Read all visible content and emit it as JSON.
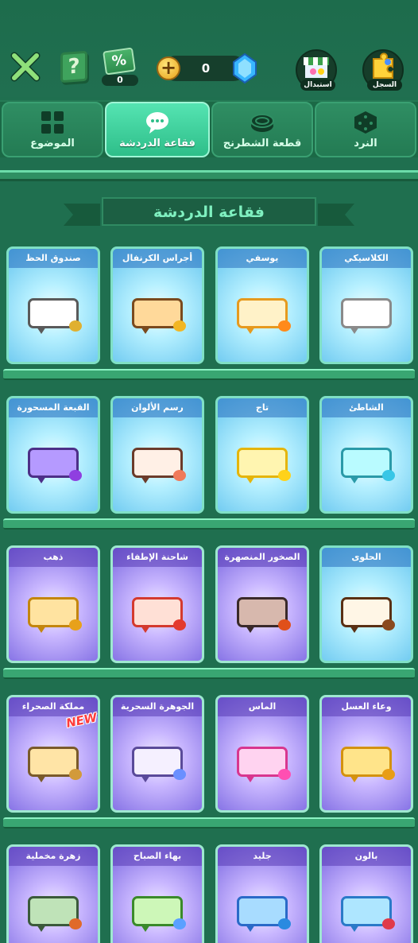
{
  "header": {
    "coupon_count": "0",
    "gem_count": "0",
    "exchange_label": "استبدال",
    "record_label": "السجل"
  },
  "tabs": [
    {
      "label": "الموضوع",
      "icon": "grid-icon",
      "active": false
    },
    {
      "label": "فقاعة الدردشة",
      "icon": "chat-bubble-icon",
      "active": true
    },
    {
      "label": "قطعة الشطرنج",
      "icon": "checker-piece-icon",
      "active": false
    },
    {
      "label": "النرد",
      "icon": "dice-icon",
      "active": false
    }
  ],
  "section_title": "فقاعة الدردشة",
  "new_badge": "NEW",
  "rows": [
    [
      {
        "name": "صندوق الحظ",
        "bg": "blue",
        "bubble": "#ffffff",
        "border": "#5a5a5a",
        "deco": "#e0b030"
      },
      {
        "name": "أجراس الكرنفال",
        "bg": "blue",
        "bubble": "#ffd99a",
        "border": "#7a4a1e",
        "deco": "#f2b624"
      },
      {
        "name": "يوسفي",
        "bg": "blue",
        "bubble": "#fff2c8",
        "border": "#e69a1e",
        "deco": "#ff8a1a"
      },
      {
        "name": "الكلاسيكي",
        "bg": "blue",
        "bubble": "#ffffff",
        "border": "#8a8a8a",
        "deco": ""
      }
    ],
    [
      {
        "name": "القبعة المسحورة",
        "bg": "blue",
        "bubble": "#b59aff",
        "border": "#4d2f88",
        "deco": "#8f3fe0"
      },
      {
        "name": "رسم الألوان",
        "bg": "blue",
        "bubble": "#fff0e6",
        "border": "#6b3b2a",
        "deco": "#f07a5a"
      },
      {
        "name": "تاج",
        "bg": "blue",
        "bubble": "#fff5b0",
        "border": "#e5b50a",
        "deco": "#ffd21a"
      },
      {
        "name": "الشاطئ",
        "bg": "blue",
        "bubble": "#b9fbff",
        "border": "#2a9aa8",
        "deco": "#37c6e6"
      }
    ],
    [
      {
        "name": "ذهب",
        "bg": "purple",
        "bubble": "#ffe3a0",
        "border": "#c4860d",
        "deco": "#e8a11a"
      },
      {
        "name": "شاحنة الإطفاء",
        "bg": "purple",
        "bubble": "#ffe0d6",
        "border": "#d43a2f",
        "deco": "#e33a2e"
      },
      {
        "name": "الصخور المنصهرة",
        "bg": "purple",
        "bubble": "#d7b8ad",
        "border": "#3a2a2a",
        "deco": "#e0501a"
      },
      {
        "name": "الحلوى",
        "bg": "blue",
        "bubble": "#fff6e6",
        "border": "#5a3014",
        "deco": "#8a4a1e"
      }
    ],
    [
      {
        "name": "مملكة الصحراء",
        "bg": "purple",
        "bubble": "#ffe4a6",
        "border": "#7a5a2a",
        "deco": "#d29a3a",
        "new": true
      },
      {
        "name": "الجوهرة السحرية",
        "bg": "purple",
        "bubble": "#f5f0ff",
        "border": "#5a4a9a",
        "deco": "#6a8fff"
      },
      {
        "name": "الماس",
        "bg": "purple",
        "bubble": "#ffd3f0",
        "border": "#d8368f",
        "deco": "#ff4fb2"
      },
      {
        "name": "وعاء العسل",
        "bg": "purple",
        "bubble": "#ffe48a",
        "border": "#d4920e",
        "deco": "#e89d16"
      }
    ],
    [
      {
        "name": "زهرة مخملية",
        "bg": "purple",
        "bubble": "#bfe3b8",
        "border": "#3b5a3b",
        "deco": "#e06a2a"
      },
      {
        "name": "بهاء الصباح",
        "bg": "purple",
        "bubble": "#cdf7b8",
        "border": "#3a8a2a",
        "deco": "#5aa0ff"
      },
      {
        "name": "جليد",
        "bg": "purple",
        "bubble": "#a8dcff",
        "border": "#2a6ac8",
        "deco": "#2a8ae0"
      },
      {
        "name": "بالون",
        "bg": "purple",
        "bubble": "#aee6ff",
        "border": "#2a7ac8",
        "deco": "#e03a4a"
      }
    ]
  ]
}
